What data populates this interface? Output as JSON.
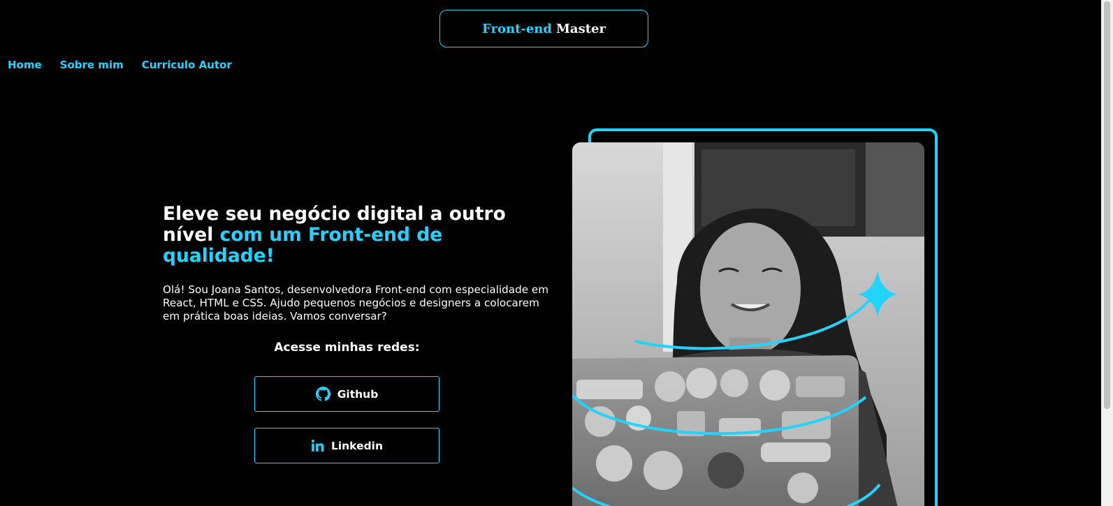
{
  "header": {
    "logo_accent": "Front-end",
    "logo_main": "Master"
  },
  "nav": {
    "items": [
      {
        "label": "Home"
      },
      {
        "label": "Sobre mim"
      },
      {
        "label": "Curriculo Autor"
      }
    ]
  },
  "hero": {
    "title_white": "Eleve seu negócio digital a outro nível",
    "title_accent": "com um Front-end de qualidade!",
    "description": "Olá! Sou Joana Santos, desenvolvedora Front-end com especialidade em React, HTML e CSS. Ajudo pequenos negócios e designers a colocarem em prática boas ideias. Vamos conversar?",
    "socials_title": "Acesse minhas redes:",
    "github_label": "Github",
    "linkedin_label": "Linkedin"
  },
  "image": {
    "alt": "Joana Santos"
  },
  "colors": {
    "accent": "#22d4fd",
    "background": "#000000",
    "text": "#ffffff"
  },
  "icons": {
    "github": "github-icon",
    "linkedin": "linkedin-icon"
  }
}
